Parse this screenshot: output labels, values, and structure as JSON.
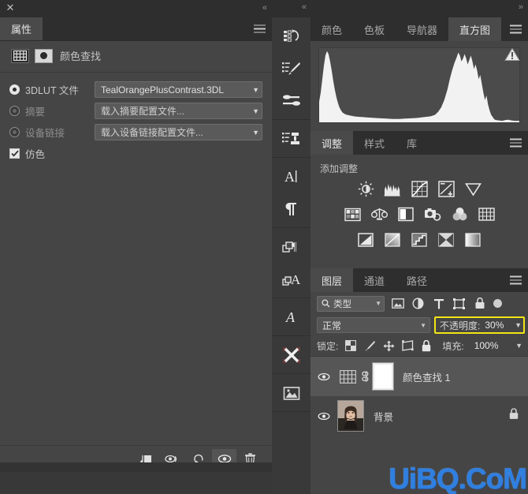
{
  "properties_panel": {
    "close_label": "✕",
    "collapse_label": "«",
    "tabs": [
      {
        "label": "属性",
        "active": true
      }
    ],
    "adjustment": {
      "title": "颜色查找",
      "grid_icon": "grid-icon",
      "mask_icon": "mask-thumbnail-icon"
    },
    "options": [
      {
        "id": "3dlut",
        "label": "3DLUT 文件",
        "selected": true,
        "dropdown_value": "TealOrangePlusContrast.3DL"
      },
      {
        "id": "abstract",
        "label": "摘要",
        "selected": false,
        "dropdown_value": "载入摘要配置文件..."
      },
      {
        "id": "devicelink",
        "label": "设备链接",
        "selected": false,
        "dropdown_value": "载入设备链接配置文件..."
      }
    ],
    "dither": {
      "label": "仿色",
      "checked": true
    },
    "footer_buttons": [
      {
        "name": "clip-to-layer-button",
        "icon": "clip-to-layer-icon",
        "selected": false
      },
      {
        "name": "view-previous-state-button",
        "icon": "eye-previous-icon",
        "selected": false
      },
      {
        "name": "reset-button",
        "icon": "reset-arrow-icon",
        "selected": false
      },
      {
        "name": "toggle-visibility-button",
        "icon": "eye-icon",
        "selected": true
      },
      {
        "name": "delete-button",
        "icon": "trash-icon",
        "selected": false
      }
    ]
  },
  "icon_rail": {
    "collapse_label": "«",
    "groups": [
      {
        "buttons": [
          {
            "name": "history-panel-icon",
            "icon": "history-icon"
          },
          {
            "name": "brush-presets-icon",
            "icon": "brush-presets-icon"
          },
          {
            "name": "brush-settings-icon",
            "icon": "brush-settings-icon"
          }
        ]
      },
      {
        "buttons": [
          {
            "name": "clone-source-icon",
            "icon": "clone-stamp-icon"
          }
        ]
      },
      {
        "buttons": [
          {
            "name": "character-panel-icon",
            "icon": "character-A-icon"
          },
          {
            "name": "paragraph-panel-icon",
            "icon": "pilcrow-icon"
          }
        ]
      },
      {
        "buttons": [
          {
            "name": "character-styles-icon",
            "icon": "character-styles-icon"
          },
          {
            "name": "paragraph-styles-icon",
            "icon": "paragraph-styles-icon"
          }
        ]
      },
      {
        "buttons": [
          {
            "name": "glyphs-panel-icon",
            "icon": "glyphs-A-icon"
          }
        ]
      },
      {
        "buttons": [
          {
            "name": "three-d-panel-icon",
            "icon": "x-cross-icon"
          }
        ]
      },
      {
        "buttons": [
          {
            "name": "libraries-panel-icon",
            "icon": "image-frame-icon"
          }
        ]
      }
    ]
  },
  "dock": {
    "collapse_label": "»",
    "histogram_group": {
      "tabs": [
        {
          "label": "颜色",
          "active": false
        },
        {
          "label": "色板",
          "active": false
        },
        {
          "label": "导航器",
          "active": false
        },
        {
          "label": "直方图",
          "active": true
        }
      ],
      "warning_icon": "warning-triangle-icon"
    },
    "adjustments_group": {
      "tabs": [
        {
          "label": "调整",
          "active": true
        },
        {
          "label": "样式",
          "active": false
        },
        {
          "label": "库",
          "active": false
        }
      ],
      "subtitle": "添加调整",
      "icons": [
        [
          {
            "name": "brightness-contrast-icon"
          },
          {
            "name": "levels-icon"
          },
          {
            "name": "curves-icon"
          },
          {
            "name": "exposure-icon"
          },
          {
            "name": "vibrance-icon"
          }
        ],
        [
          {
            "name": "hue-saturation-icon"
          },
          {
            "name": "color-balance-icon"
          },
          {
            "name": "black-and-white-icon"
          },
          {
            "name": "photo-filter-icon"
          },
          {
            "name": "channel-mixer-icon"
          },
          {
            "name": "color-lookup-icon"
          }
        ],
        [
          {
            "name": "invert-icon"
          },
          {
            "name": "posterize-icon"
          },
          {
            "name": "threshold-icon"
          },
          {
            "name": "gradient-map-icon"
          },
          {
            "name": "selective-color-icon"
          }
        ]
      ]
    },
    "layers_group": {
      "tabs": [
        {
          "label": "图层",
          "active": true
        },
        {
          "label": "通道",
          "active": false
        },
        {
          "label": "路径",
          "active": false
        }
      ],
      "filter": {
        "search_icon": "search-icon",
        "value": "类型",
        "icons": [
          {
            "name": "filter-pixel-layers-icon"
          },
          {
            "name": "filter-adjustment-layers-icon"
          },
          {
            "name": "filter-type-layers-icon"
          },
          {
            "name": "filter-shape-layers-icon"
          },
          {
            "name": "filter-smart-objects-icon"
          }
        ],
        "toggle_name": "filter-enable-toggle"
      },
      "blend_mode": "正常",
      "opacity_label": "不透明度:",
      "opacity_value": "30%",
      "opacity_highlight_color": "#f2e516",
      "lock_label": "锁定:",
      "lock_icons": [
        {
          "name": "lock-transparent-pixels-icon"
        },
        {
          "name": "lock-image-pixels-icon"
        },
        {
          "name": "lock-position-icon"
        },
        {
          "name": "lock-artboard-nesting-icon"
        },
        {
          "name": "lock-all-icon"
        }
      ],
      "fill_label": "填充:",
      "fill_value": "100%",
      "layers": [
        {
          "name": "颜色查找 1",
          "visible": true,
          "selected": true,
          "thumb_type": "color-lookup",
          "has_mask": true,
          "has_link": true,
          "locked": false
        },
        {
          "name": "背景",
          "visible": true,
          "selected": false,
          "thumb_type": "photo",
          "has_mask": false,
          "has_link": false,
          "locked": true
        }
      ]
    }
  },
  "watermark": {
    "text": "UiBQ.CoM",
    "color": "#2f7fe0"
  }
}
